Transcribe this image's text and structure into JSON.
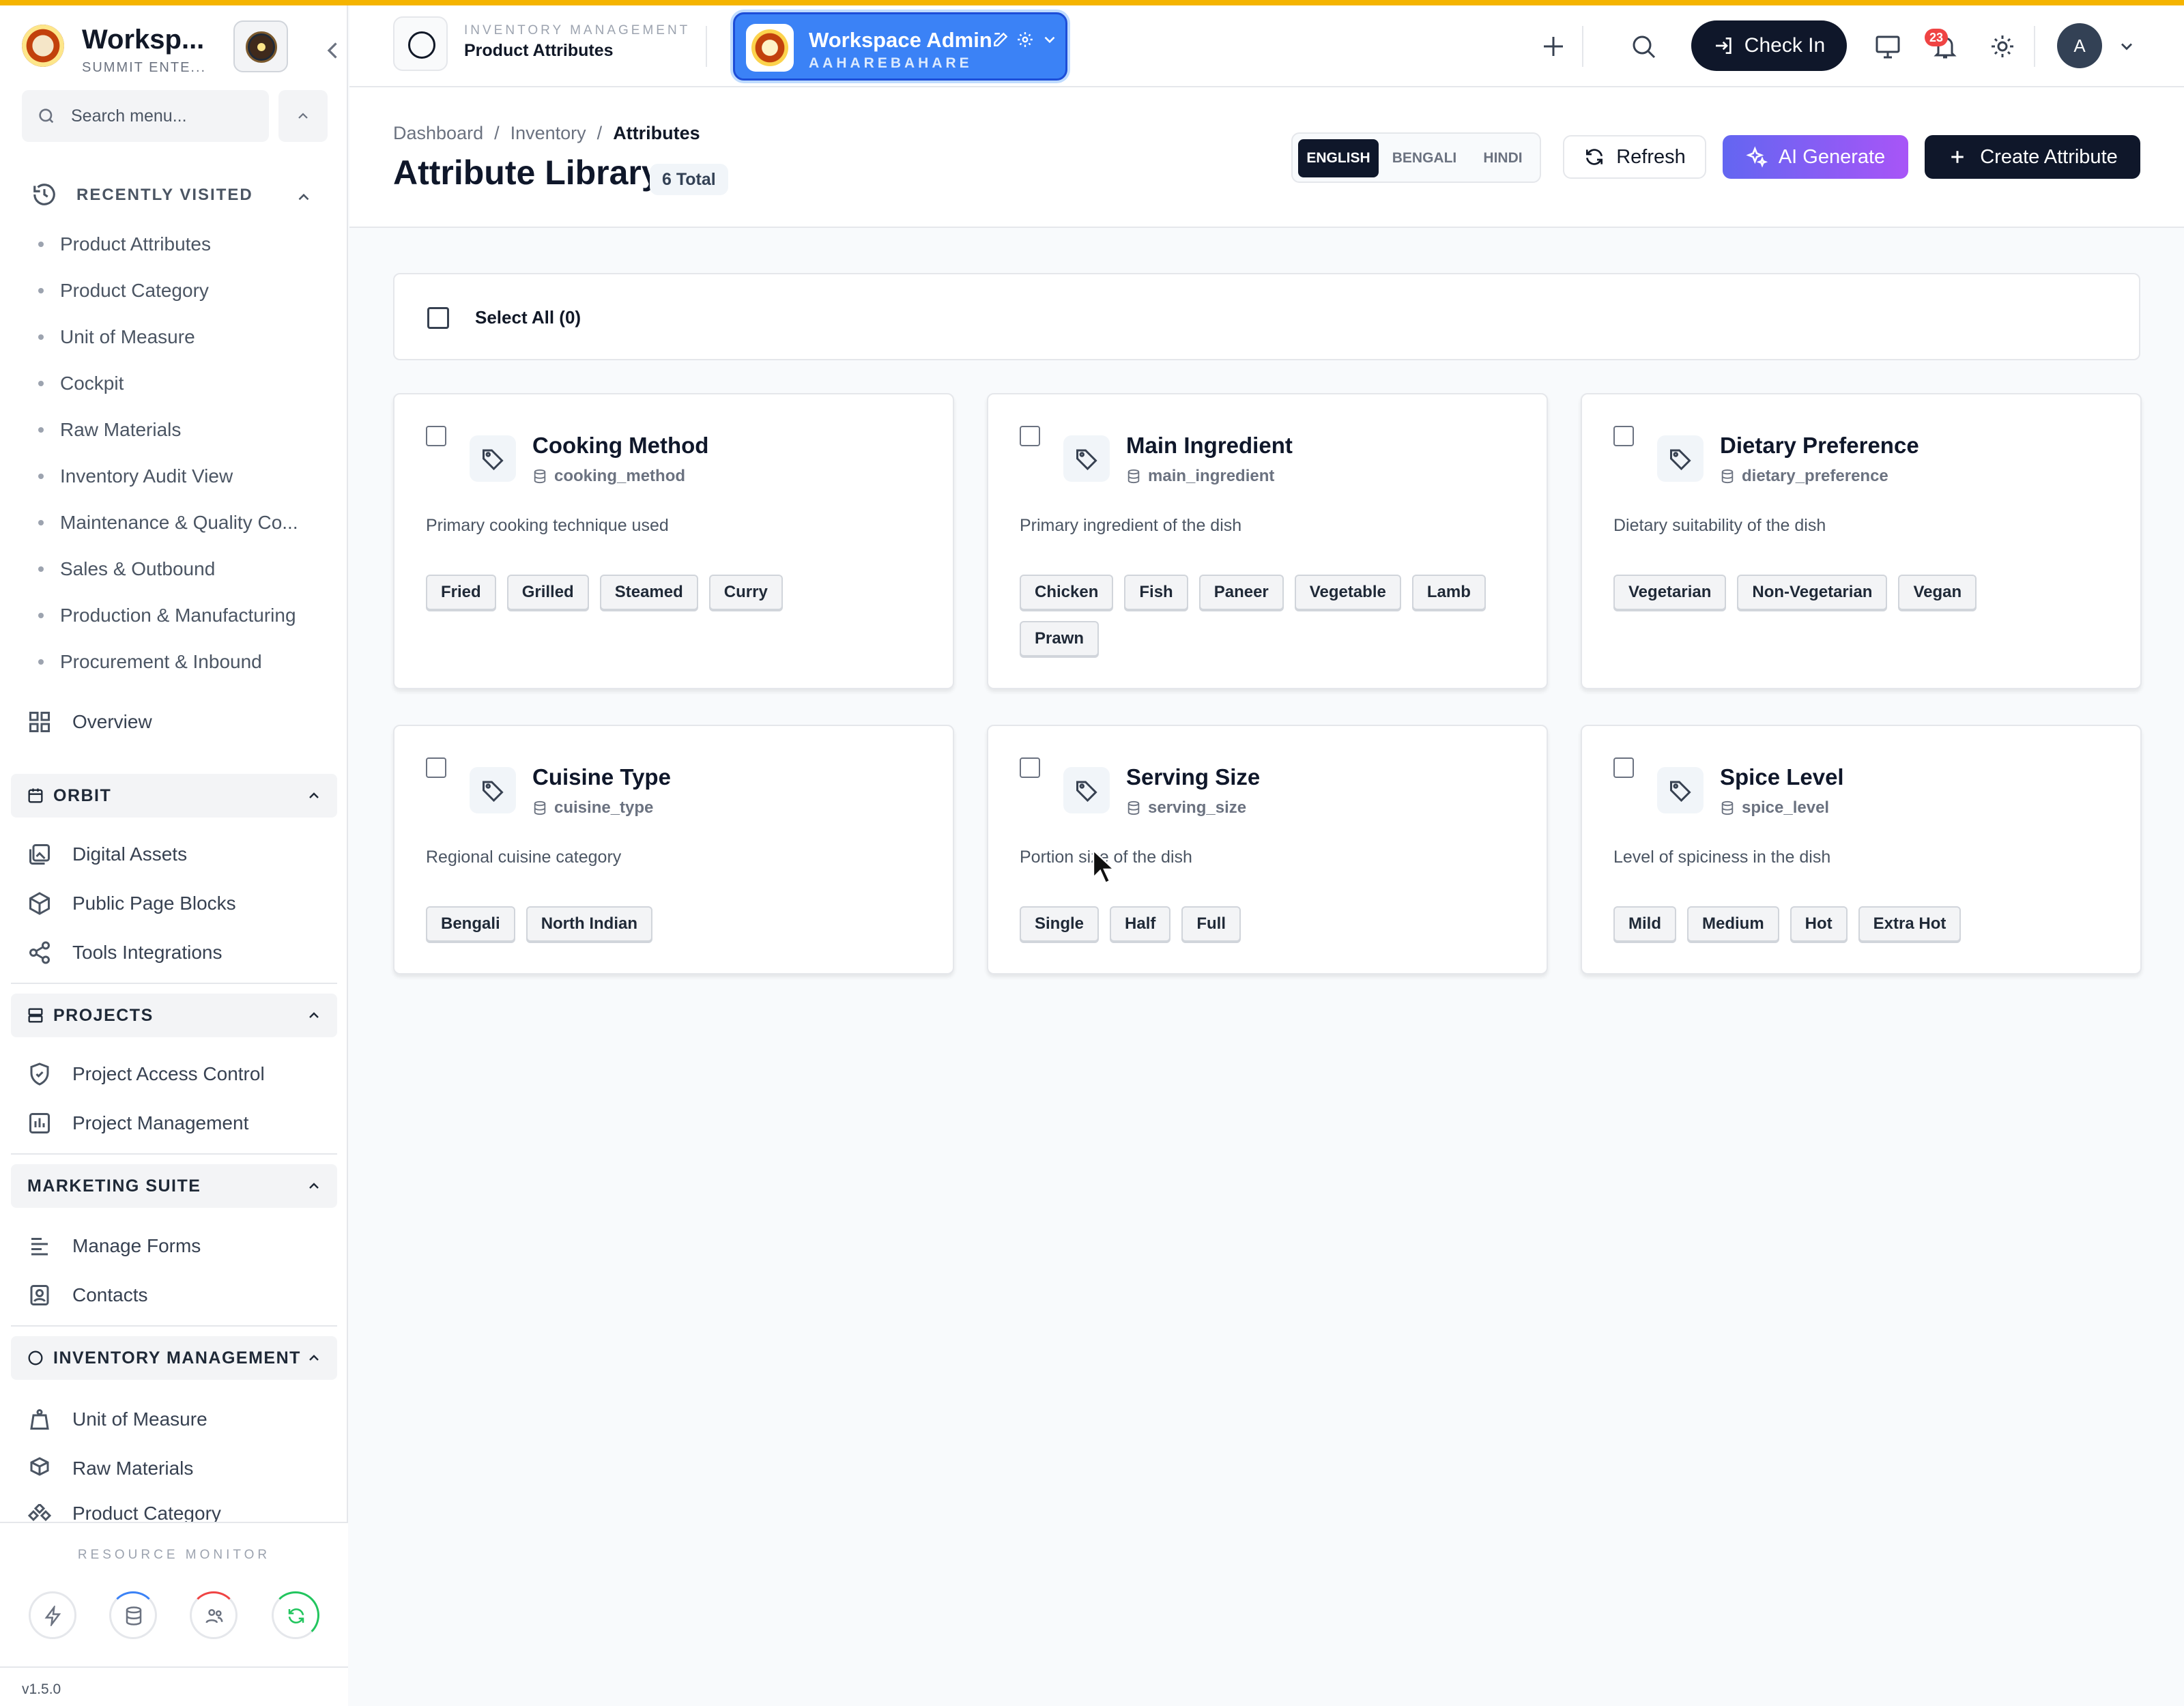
{
  "brand": {
    "title": "Worksp...",
    "subtitle": "SUMMIT ENTE..."
  },
  "search": {
    "placeholder": "Search menu..."
  },
  "recently_visited": {
    "title": "RECENTLY VISITED",
    "items": [
      "Product Attributes",
      "Product Category",
      "Unit of Measure",
      "Cockpit",
      "Raw Materials",
      "Inventory Audit View",
      "Maintenance & Quality Co...",
      "Sales & Outbound",
      "Production & Manufacturing",
      "Procurement & Inbound"
    ]
  },
  "nav": {
    "overview": "Overview"
  },
  "groups": {
    "orbit": {
      "title": "ORBIT",
      "items": [
        "Digital Assets",
        "Public Page Blocks",
        "Tools Integrations"
      ]
    },
    "projects": {
      "title": "PROJECTS",
      "items": [
        "Project Access Control",
        "Project Management"
      ]
    },
    "marketing": {
      "title": "MARKETING SUITE",
      "items": [
        "Manage Forms",
        "Contacts"
      ]
    },
    "inventory": {
      "title": "INVENTORY MANAGEMENT",
      "items": [
        "Unit of Measure",
        "Raw Materials",
        "Product Category"
      ]
    }
  },
  "resource_monitor": {
    "title": "RESOURCE MONITOR"
  },
  "version": "v1.5.0",
  "topbar": {
    "module_label": "INVENTORY MANAGEMENT",
    "module_page": "Product Attributes",
    "workspace_title": "Workspace Admin",
    "workspace_sub": "AAHAREBAHARE",
    "checkin": "Check In",
    "notifications": "23",
    "avatar": "A"
  },
  "header": {
    "breadcrumb": [
      "Dashboard",
      "Inventory",
      "Attributes"
    ],
    "separator": "/",
    "title": "Attribute Library",
    "total": "6 Total",
    "languages": [
      "ENGLISH",
      "BENGALI",
      "HINDI"
    ],
    "active_language": "ENGLISH",
    "refresh": "Refresh",
    "ai_generate": "AI Generate",
    "create": "Create Attribute"
  },
  "select_all": "Select All (0)",
  "cards": [
    {
      "title": "Cooking Method",
      "key": "cooking_method",
      "desc": "Primary cooking technique used",
      "values": [
        "Fried",
        "Grilled",
        "Steamed",
        "Curry"
      ]
    },
    {
      "title": "Main Ingredient",
      "key": "main_ingredient",
      "desc": "Primary ingredient of the dish",
      "values": [
        "Chicken",
        "Fish",
        "Paneer",
        "Vegetable",
        "Lamb",
        "Prawn"
      ]
    },
    {
      "title": "Dietary Preference",
      "key": "dietary_preference",
      "desc": "Dietary suitability of the dish",
      "values": [
        "Vegetarian",
        "Non-Vegetarian",
        "Vegan"
      ]
    },
    {
      "title": "Cuisine Type",
      "key": "cuisine_type",
      "desc": "Regional cuisine category",
      "values": [
        "Bengali",
        "North Indian"
      ]
    },
    {
      "title": "Serving Size",
      "key": "serving_size",
      "desc": "Portion size of the dish",
      "values": [
        "Single",
        "Half",
        "Full"
      ]
    },
    {
      "title": "Spice Level",
      "key": "spice_level",
      "desc": "Level of spiciness in the dish",
      "values": [
        "Mild",
        "Medium",
        "Hot",
        "Extra Hot"
      ]
    }
  ],
  "colors": {
    "accent_stripe": "#f5b400",
    "workspace_blue": "#3b82f6",
    "primary_dark": "#0f172a",
    "ai_gradient_start": "#6366f1",
    "ai_gradient_end": "#a855f7",
    "notification_red": "#ef4444"
  }
}
